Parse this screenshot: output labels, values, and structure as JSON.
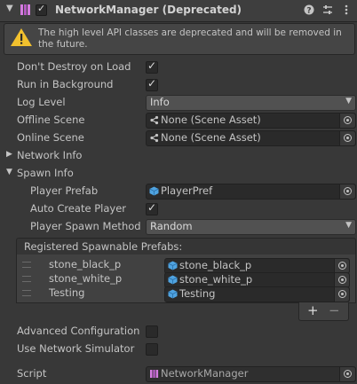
{
  "header": {
    "title": "NetworkManager (Deprecated)",
    "enabled": true,
    "icons": [
      "help-icon",
      "presets-icon",
      "more-icon"
    ]
  },
  "warning": {
    "icon": "warning-icon",
    "text": "The high level API classes are deprecated and will be removed in the future."
  },
  "fields": {
    "dont_destroy": {
      "label": "Don't Destroy on Load",
      "checked": true
    },
    "run_background": {
      "label": "Run in Background",
      "checked": true
    },
    "log_level": {
      "label": "Log Level",
      "value": "Info"
    },
    "offline_scene": {
      "label": "Offline Scene",
      "value": "None (Scene Asset)"
    },
    "online_scene": {
      "label": "Online Scene",
      "value": "None (Scene Asset)"
    },
    "network_info": {
      "label": "Network Info",
      "expanded": false
    },
    "spawn_info": {
      "label": "Spawn Info",
      "expanded": true
    },
    "player_prefab": {
      "label": "Player Prefab",
      "value": "PlayerPref"
    },
    "auto_create": {
      "label": "Auto Create Player",
      "checked": true
    },
    "spawn_method": {
      "label": "Player Spawn Method",
      "value": "Random"
    },
    "advanced": {
      "label": "Advanced Configuration",
      "checked": false
    },
    "simulator": {
      "label": "Use Network Simulator",
      "checked": false
    },
    "script": {
      "label": "Script",
      "value": "NetworkManager"
    }
  },
  "spawnable": {
    "title": "Registered Spawnable Prefabs:",
    "items": [
      {
        "name": "stone_black_p",
        "value": "stone_black_p"
      },
      {
        "name": "stone_white_p",
        "value": "stone_white_p"
      },
      {
        "name": "Testing",
        "value": "Testing"
      }
    ],
    "add": "+",
    "remove": "−"
  },
  "glyphs": {
    "check": "✓",
    "caret": "▼",
    "expanded": "▼",
    "collapsed": "▶"
  },
  "colors": {
    "background": "#383838",
    "field": "#2a2a2a",
    "text": "#c4c4c4",
    "prefab_icon": "#4fa3e0",
    "warning": "#f2c12e"
  }
}
